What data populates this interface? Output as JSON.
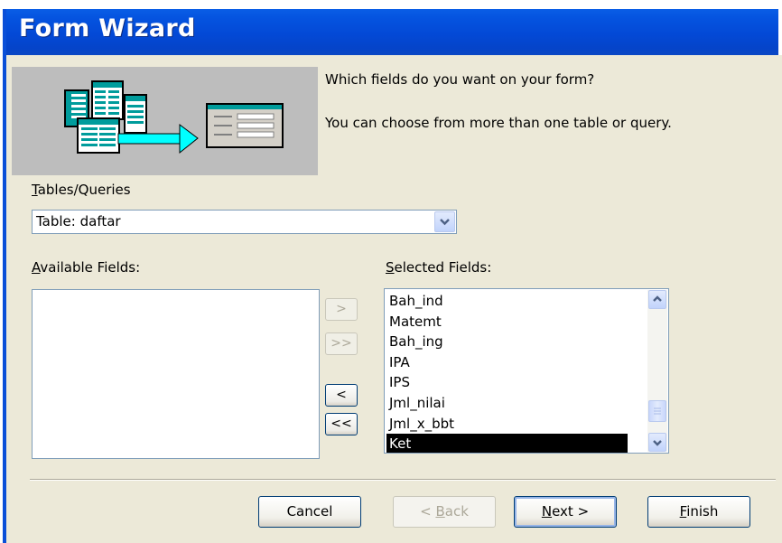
{
  "window": {
    "title": "Form Wizard"
  },
  "header": {
    "question": "Which fields do you want on your form?",
    "hint": "You can choose from more than one table or query."
  },
  "tables_queries": {
    "label_accel": "T",
    "label_rest": "ables/Queries",
    "value": "Table: daftar"
  },
  "available_fields": {
    "label_accel": "A",
    "label_rest": "vailable Fields:",
    "items": []
  },
  "selected_fields": {
    "label_accel": "S",
    "label_rest": "elected Fields:",
    "items": [
      "Bah_ind",
      "Matemt",
      "Bah_ing",
      "IPA",
      "IPS",
      "Jml_nilai",
      "Jml_x_bbt",
      "Ket"
    ],
    "selected_item": "Ket"
  },
  "move_buttons": {
    "add_one": ">",
    "add_all": ">>",
    "remove_one": "<",
    "remove_all": "<<"
  },
  "buttons": {
    "cancel": "Cancel",
    "back_pre": "< ",
    "back_accel": "B",
    "back_rest": "ack",
    "next_accel": "N",
    "next_rest": "ext >",
    "finish_accel": "F",
    "finish_rest": "inish"
  },
  "colors": {
    "titlebar": "#0554e0",
    "dialog_bg": "#ece9d8",
    "picture_bg": "#bdbdbd",
    "arrow": "#00ffff",
    "selection": "#000000"
  }
}
